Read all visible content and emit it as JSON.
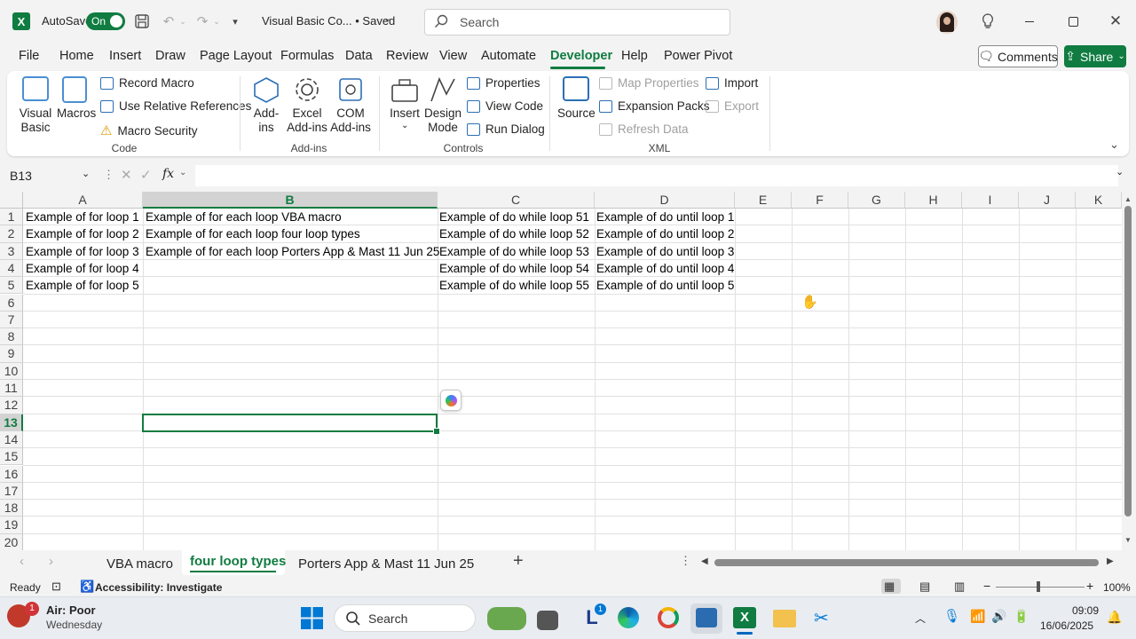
{
  "titlebar": {
    "autosave_label": "AutoSave",
    "toggle_label": "On",
    "doc_title": "Visual Basic Co... • Saved",
    "search_placeholder": "Search"
  },
  "menu": {
    "items": [
      "File",
      "Home",
      "Insert",
      "Draw",
      "Page Layout",
      "Formulas",
      "Data",
      "Review",
      "View",
      "Automate",
      "Developer",
      "Help",
      "Power Pivot"
    ],
    "active": "Developer",
    "comments_label": "Comments",
    "share_label": "Share"
  },
  "ribbon": {
    "code": {
      "label": "Code",
      "visual_basic": "Visual Basic",
      "macros": "Macros",
      "record_macro": "Record Macro",
      "use_relative": "Use Relative References",
      "macro_security": "Macro Security"
    },
    "addins": {
      "label": "Add-ins",
      "addins": "Add-ins",
      "excel_addins": "Excel Add-ins",
      "com_addins": "COM Add-ins"
    },
    "controls": {
      "label": "Controls",
      "insert": "Insert",
      "design_mode": "Design Mode",
      "properties": "Properties",
      "view_code": "View Code",
      "run_dialog": "Run Dialog"
    },
    "xml": {
      "label": "XML",
      "source": "Source",
      "map_properties": "Map Properties",
      "expansion_packs": "Expansion Packs",
      "refresh_data": "Refresh Data",
      "import": "Import",
      "export": "Export"
    }
  },
  "formula_bar": {
    "name_box": "B13",
    "fx": "fx",
    "value": ""
  },
  "sheet": {
    "columns": [
      "A",
      "B",
      "C",
      "D",
      "E",
      "F",
      "G",
      "H",
      "I",
      "J",
      "K"
    ],
    "rows": [
      "1",
      "2",
      "3",
      "4",
      "5",
      "6",
      "7",
      "8",
      "9",
      "10",
      "11",
      "12",
      "13",
      "14",
      "15",
      "16",
      "17",
      "18",
      "19",
      "20"
    ],
    "selected_cell": "B13",
    "cells": {
      "A": [
        "Example of for loop 1",
        "Example of for loop 2",
        "Example of for loop 3",
        "Example of for loop 4",
        "Example of for loop 5"
      ],
      "B": [
        "Example of for each loop VBA macro",
        "Example of for each loop four loop types",
        "Example of for each loop Porters App & Mast  11 Jun 25",
        "",
        ""
      ],
      "C": [
        "Example of do while loop 51",
        "Example of do while loop 52",
        "Example of do while loop 53",
        "Example of do while loop 54",
        "Example of do while loop 55"
      ],
      "D": [
        "Example of do until loop 1",
        "Example of do until loop 2",
        "Example of do until loop 3",
        "Example of do until loop 4",
        "Example of do until loop 5"
      ]
    }
  },
  "sheet_tabs": {
    "tabs": [
      "VBA macro",
      "four loop types",
      "Porters App & Mast  11 Jun 25"
    ],
    "active": "four loop types"
  },
  "statusbar": {
    "ready": "Ready",
    "accessibility": "Accessibility: Investigate",
    "zoom": "100%"
  },
  "taskbar": {
    "weather_badge": "1",
    "weather_title": "Air: Poor",
    "weather_sub": "Wednesday",
    "search": "Search",
    "time": "09:09",
    "date": "16/06/2025"
  },
  "colors": {
    "accent": "#107c41"
  }
}
